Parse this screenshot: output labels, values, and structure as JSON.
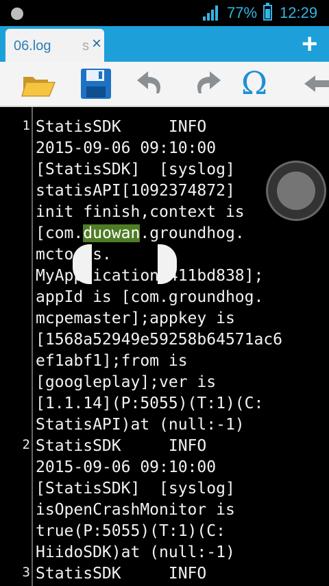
{
  "status": {
    "battery_percent": "77%",
    "time": "12:29",
    "battery_level": 0.77
  },
  "tabs": {
    "active_title": "06.log",
    "peek_char": "s",
    "close_glyph": "×",
    "add_glyph": "+"
  },
  "toolbar": {
    "items": [
      "open-folder-icon",
      "save-icon",
      "undo-icon",
      "redo-icon",
      "omega-icon",
      "back-arrow-icon"
    ],
    "omega_glyph": "Ω"
  },
  "editor": {
    "lines": [
      {
        "no": "1",
        "text": "StatisSDK     INFO"
      },
      {
        "no": "",
        "text": "2015-09-06 09:10:00"
      },
      {
        "no": "",
        "text": "[StatisSDK]  [syslog]"
      },
      {
        "no": "",
        "text": "statisAPI[1092374872]"
      },
      {
        "no": "",
        "text": "init finish,context is"
      },
      {
        "no": "",
        "pre": "[com.",
        "hl": "duowan",
        "post": ".groundhog."
      },
      {
        "no": "",
        "text": "mctools."
      },
      {
        "no": "",
        "text": "MyApplication@411bd838];"
      },
      {
        "no": "",
        "text": "appId is [com.groundhog."
      },
      {
        "no": "",
        "text": "mcpemaster];appkey is"
      },
      {
        "no": "",
        "text": "[1568a52949e59258b64571ac6"
      },
      {
        "no": "",
        "text": "ef1abf1];from is"
      },
      {
        "no": "",
        "text": "[googleplay];ver is"
      },
      {
        "no": "",
        "text": "[1.1.14](P:5055)(T:1)(C:"
      },
      {
        "no": "",
        "text": "StatisAPI)at (null:-1)"
      },
      {
        "no": "2",
        "text": "StatisSDK     INFO"
      },
      {
        "no": "",
        "text": "2015-09-06 09:10:00"
      },
      {
        "no": "",
        "text": "[StatisSDK]  [syslog]"
      },
      {
        "no": "",
        "text": "isOpenCrashMonitor is"
      },
      {
        "no": "",
        "text": "true(P:5055)(T:1)(C:"
      },
      {
        "no": "",
        "text": "HiidoSDK)at (null:-1)"
      },
      {
        "no": "3",
        "text": "StatisSDK     INFO"
      }
    ]
  },
  "colors": {
    "accent": "#1da0d9",
    "status_text": "#33b5e5",
    "selection": "#4f7d25"
  }
}
